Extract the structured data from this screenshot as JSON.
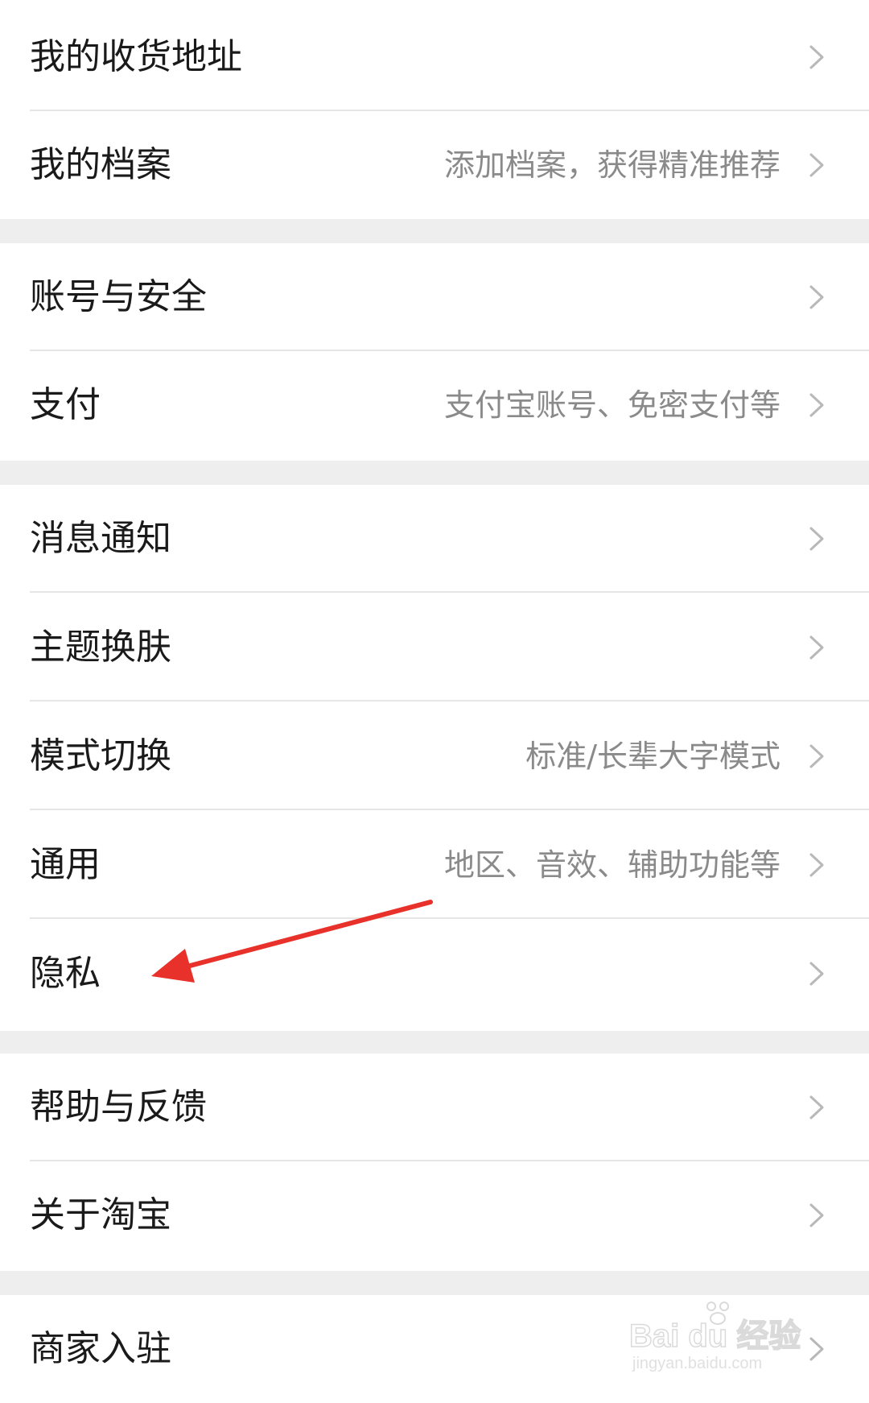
{
  "settings": {
    "rows": [
      {
        "label": "我的收货地址",
        "sub": ""
      },
      {
        "label": "我的档案",
        "sub": "添加档案，获得精准推荐"
      },
      {
        "label": "账号与安全",
        "sub": ""
      },
      {
        "label": "支付",
        "sub": "支付宝账号、免密支付等"
      },
      {
        "label": "消息通知",
        "sub": ""
      },
      {
        "label": "主题换肤",
        "sub": ""
      },
      {
        "label": "模式切换",
        "sub": "标准/长辈大字模式"
      },
      {
        "label": "通用",
        "sub": "地区、音效、辅助功能等"
      },
      {
        "label": "隐私",
        "sub": ""
      },
      {
        "label": "帮助与反馈",
        "sub": ""
      },
      {
        "label": "关于淘宝",
        "sub": ""
      },
      {
        "label": "商家入驻",
        "sub": ""
      }
    ]
  },
  "annotation": {
    "arrow_color": "#e8312a",
    "icon": "red-arrow-icon"
  },
  "watermark": {
    "main": "Bai du 经验",
    "sub": "jingyan.baidu.com"
  },
  "colors": {
    "background": "#ffffff",
    "separator": "#eeeeee",
    "label": "#1a1a1a",
    "sublabel": "#8a8a8a",
    "chevron": "#b8b8b8"
  }
}
